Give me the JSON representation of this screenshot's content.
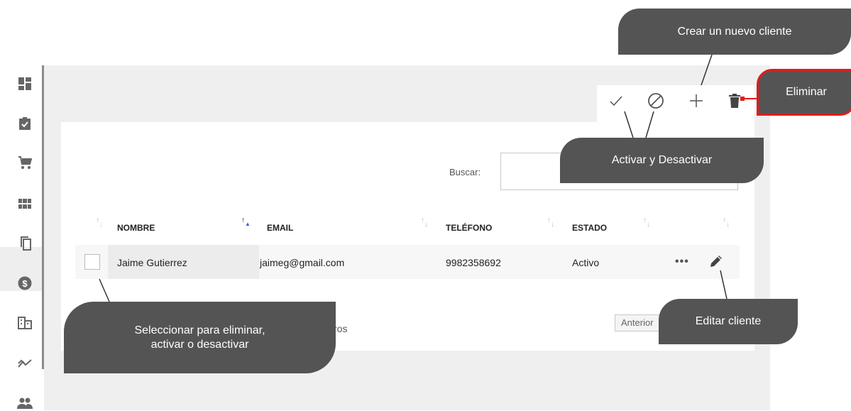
{
  "sidebar": {
    "items": [
      {
        "icon": "dashboard-icon"
      },
      {
        "icon": "clipboard-check-icon"
      },
      {
        "icon": "cart-icon"
      },
      {
        "icon": "grid-icon",
        "active": true
      },
      {
        "icon": "copy-icon"
      },
      {
        "icon": "dollar-icon"
      },
      {
        "icon": "building-icon"
      },
      {
        "icon": "trending-icon"
      },
      {
        "icon": "people-icon"
      }
    ]
  },
  "toolbar": {
    "activate_icon": "check-icon",
    "deactivate_icon": "block-icon",
    "add_icon": "plus-icon",
    "delete_icon": "trash-icon"
  },
  "search": {
    "label": "Buscar:",
    "value": ""
  },
  "table": {
    "headers": [
      "NOMBRE",
      "EMAIL",
      "TELÉFONO",
      "ESTADO"
    ],
    "rows": [
      {
        "name": "Jaime Gutierrez",
        "email": "jaimeg@gmail.com",
        "phone": "9982358692",
        "status": "Activo",
        "more": "•••"
      }
    ]
  },
  "footer": {
    "records_fragment": "ros",
    "previous_label": "Anterior"
  },
  "callouts": {
    "create": "Crear un nuevo cliente",
    "activate": "Activar y Desactivar",
    "delete": "Eliminar",
    "edit": "Editar cliente",
    "select_line1": "Seleccionar para eliminar,",
    "select_line2": "activar o desactivar"
  },
  "colors": {
    "callout_bg": "#545454",
    "delete_border": "#e11b1b",
    "sort_active": "#3b5bdb"
  }
}
